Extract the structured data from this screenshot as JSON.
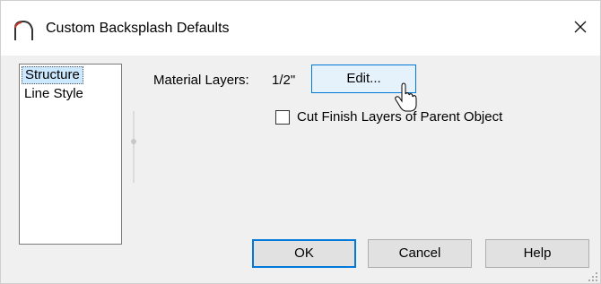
{
  "window": {
    "title": "Custom Backsplash Defaults",
    "app_icon": "arch-icon",
    "close_icon": "close-icon"
  },
  "sidebar": {
    "items": [
      {
        "label": "Structure",
        "selected": true
      },
      {
        "label": "Line Style",
        "selected": false
      }
    ]
  },
  "structure_panel": {
    "material_layers_label": "Material Layers:",
    "material_layers_value": "1/2\"",
    "edit_button_label": "Edit...",
    "cut_finish_checkbox": {
      "label": "Cut Finish Layers of Parent Object",
      "checked": false
    }
  },
  "footer": {
    "ok_label": "OK",
    "cancel_label": "Cancel",
    "help_label": "Help"
  },
  "colors": {
    "selection": "#cce8ff",
    "focus_border": "#0078d7",
    "button_face": "#e1e1e1",
    "hover_face": "#e5f1fb"
  }
}
